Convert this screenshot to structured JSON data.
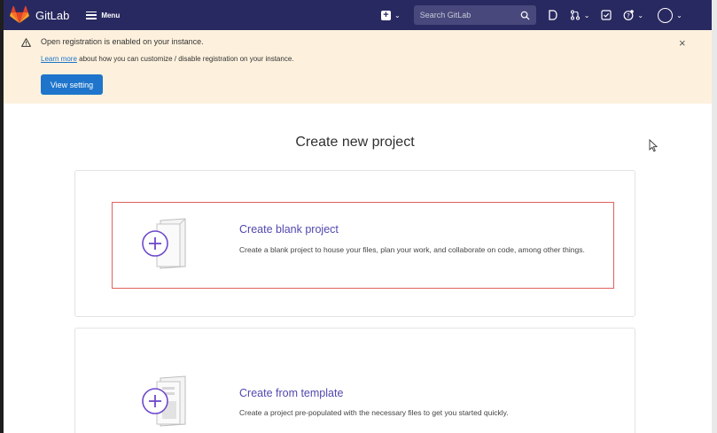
{
  "navbar": {
    "brand": "GitLab",
    "menu_label": "Menu",
    "search_placeholder": "Search GitLab"
  },
  "alert": {
    "title": "Open registration is enabled on your instance.",
    "link_text": "Learn more",
    "body_rest": " about how you can customize / disable registration on your instance.",
    "button_label": "View setting",
    "close_symbol": "×"
  },
  "page": {
    "title": "Create new project"
  },
  "options": [
    {
      "title": "Create blank project",
      "description": "Create a blank project to house your files, plan your work, and collaborate on code, among other things."
    },
    {
      "title": "Create from template",
      "description": "Create a project pre-populated with the necessary files to get you started quickly."
    }
  ],
  "colors": {
    "navbar": "#292961",
    "alert_bg": "#fdf1dd",
    "primary": "#1f75cb",
    "option_title": "#5148b0",
    "highlight_border": "#e0605f"
  },
  "icons": [
    "gitlab-logo",
    "hamburger-icon",
    "plus-square-icon",
    "search-icon",
    "issues-icon",
    "merge-request-icon",
    "todo-icon",
    "help-icon",
    "avatar-icon",
    "warning-icon",
    "close-icon",
    "cursor-icon"
  ]
}
